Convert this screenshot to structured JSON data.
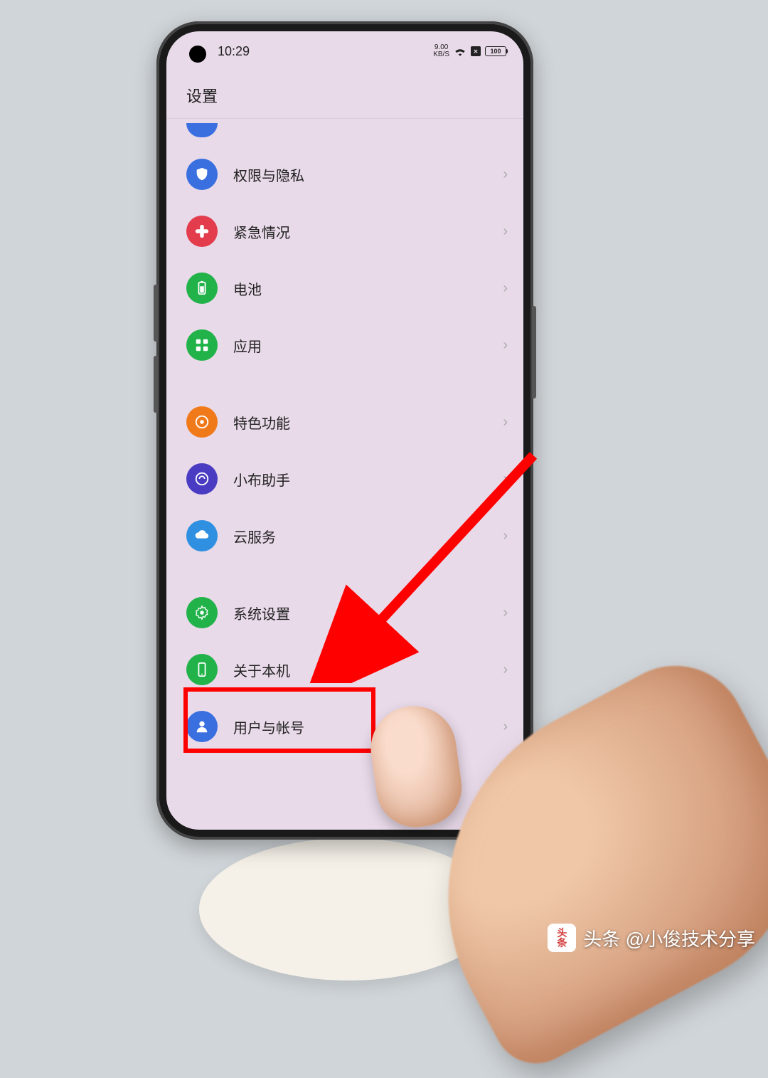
{
  "statusbar": {
    "time": "10:29",
    "net_speed_value": "9.00",
    "net_speed_unit": "KB/S",
    "battery_text": "100"
  },
  "header": {
    "title": "设置"
  },
  "items": [
    {
      "id": "privacy",
      "label": "权限与隐私",
      "color": "#3a6fe0",
      "icon": "shield"
    },
    {
      "id": "emergency",
      "label": "紧急情况",
      "color": "#e33c4c",
      "icon": "medical"
    },
    {
      "id": "battery",
      "label": "电池",
      "color": "#21b24a",
      "icon": "battery"
    },
    {
      "id": "apps",
      "label": "应用",
      "color": "#21b24a",
      "icon": "grid"
    },
    {
      "id": "special",
      "label": "特色功能",
      "color": "#f07a1a",
      "icon": "star"
    },
    {
      "id": "assistant",
      "label": "小布助手",
      "color": "#4a3cc2",
      "icon": "assistant"
    },
    {
      "id": "cloud",
      "label": "云服务",
      "color": "#2f8fe0",
      "icon": "cloud"
    },
    {
      "id": "system",
      "label": "系统设置",
      "color": "#21b24a",
      "icon": "gear"
    },
    {
      "id": "about",
      "label": "关于本机",
      "color": "#21b24a",
      "icon": "phone"
    },
    {
      "id": "users",
      "label": "用户与帐号",
      "color": "#3a6fe0",
      "icon": "user"
    }
  ],
  "annotation": {
    "highlighted_item_id": "about",
    "arrow_color": "#ff0000"
  },
  "watermark": {
    "logo_line1": "头",
    "logo_line2": "条",
    "text": "头条 @小俊技术分享"
  }
}
